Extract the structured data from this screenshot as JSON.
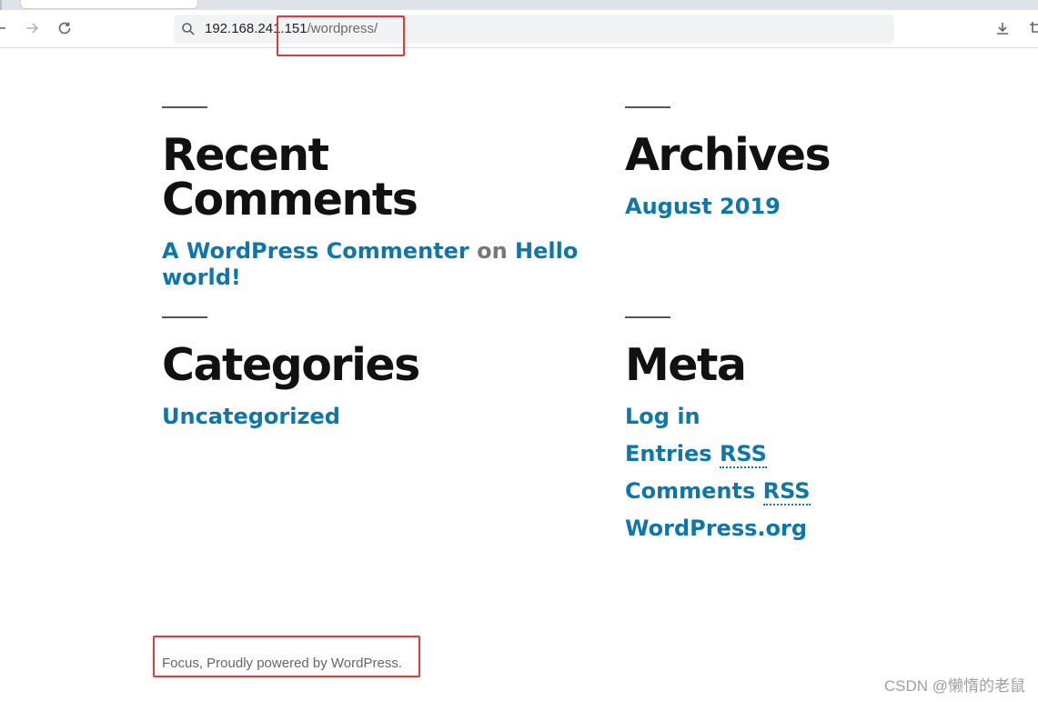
{
  "browser": {
    "url_host": "192.168.241.151",
    "url_path": "/wordpress/",
    "icons": {
      "back": "arrow-left-icon",
      "forward": "arrow-right-icon",
      "reload": "reload-icon",
      "search": "search-icon",
      "download": "download-icon",
      "crop": "crop-icon"
    }
  },
  "widgets": {
    "recent_comments": {
      "title": "Recent Comments",
      "author": "A WordPress Commenter",
      "on": "on",
      "post_line1": "Hello",
      "post_line2": "world!"
    },
    "archives": {
      "title": "Archives",
      "items": [
        "August 2019"
      ]
    },
    "categories": {
      "title": "Categories",
      "items": [
        "Uncategorized"
      ]
    },
    "meta": {
      "title": "Meta",
      "log_in": "Log in",
      "entries": "Entries",
      "comments": "Comments",
      "rss": "RSS",
      "wordpress_org": "WordPress.org"
    }
  },
  "footer": {
    "credit": "Focus, Proudly powered by WordPress."
  },
  "watermark": "CSDN @懒惰的老鼠",
  "colors": {
    "link": "#0e76a8",
    "title": "#111111",
    "highlight_box": "#e53935"
  }
}
